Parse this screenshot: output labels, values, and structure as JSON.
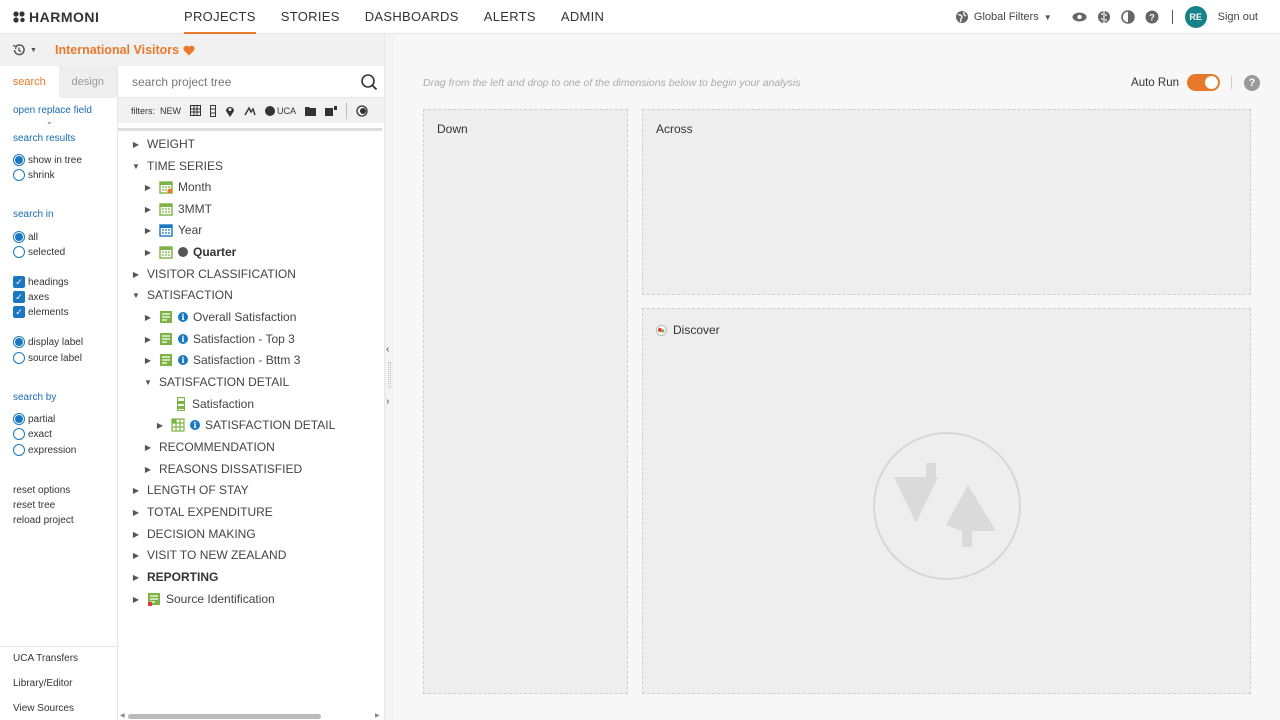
{
  "app": {
    "logo_text": "HARMONI"
  },
  "nav": {
    "items": [
      "PROJECTS",
      "STORIES",
      "DASHBOARDS",
      "ALERTS",
      "ADMIN"
    ],
    "active_index": 0
  },
  "header_right": {
    "global_filters": "Global Filters",
    "avatar_initials": "RE",
    "sign_out": "Sign out"
  },
  "project": {
    "name": "International Visitors"
  },
  "left_panel": {
    "tabs": [
      "search",
      "design"
    ],
    "open_replace_field": "open replace field",
    "search_results_heading": "search results",
    "search_results_options": [
      "show in tree",
      "shrink"
    ],
    "search_in_heading": "search in",
    "search_in_options": [
      "all",
      "selected"
    ],
    "checkbox_options": [
      "headings",
      "axes",
      "elements"
    ],
    "label_options": [
      "display label",
      "source label"
    ],
    "search_by_heading": "search by",
    "search_by_options": [
      "partial",
      "exact",
      "expression"
    ],
    "actions": [
      "reset options",
      "reset tree",
      "reload project"
    ],
    "bottom_links": [
      "UCA Transfers",
      "Library/Editor",
      "View Sources"
    ]
  },
  "tree_panel": {
    "search_placeholder": "search project tree",
    "filters_label": "filters:",
    "filters_new": "NEW",
    "filters_uca": "UCA",
    "nodes": [
      {
        "label": "WEIGHT"
      },
      {
        "label": "TIME SERIES"
      },
      {
        "label": "Month"
      },
      {
        "label": "3MMT"
      },
      {
        "label": "Year"
      },
      {
        "label": "Quarter"
      },
      {
        "label": "VISITOR CLASSIFICATION"
      },
      {
        "label": "SATISFACTION"
      },
      {
        "label": "Overall Satisfaction"
      },
      {
        "label": "Satisfaction - Top 3"
      },
      {
        "label": "Satisfaction - Bttm 3"
      },
      {
        "label": "SATISFACTION DETAIL"
      },
      {
        "label": "Satisfaction"
      },
      {
        "label": "SATISFACTION DETAIL"
      },
      {
        "label": "RECOMMENDATION"
      },
      {
        "label": "REASONS DISSATISFIED"
      },
      {
        "label": "LENGTH OF STAY"
      },
      {
        "label": "TOTAL EXPENDITURE"
      },
      {
        "label": "DECISION MAKING"
      },
      {
        "label": "VISIT TO NEW ZEALAND"
      },
      {
        "label": "REPORTING"
      },
      {
        "label": "Source Identification"
      }
    ]
  },
  "main": {
    "hint": "Drag from the left and drop to one of the dimensions below to begin your analysis",
    "auto_run_label": "Auto Run",
    "auto_run_on": true,
    "zones": {
      "down": "Down",
      "across": "Across",
      "discover": "Discover"
    }
  },
  "colors": {
    "accent": "#e8782a",
    "link_blue": "#1a6bb5",
    "avatar": "#17828a",
    "tree_icon_green": "#7cb342"
  }
}
